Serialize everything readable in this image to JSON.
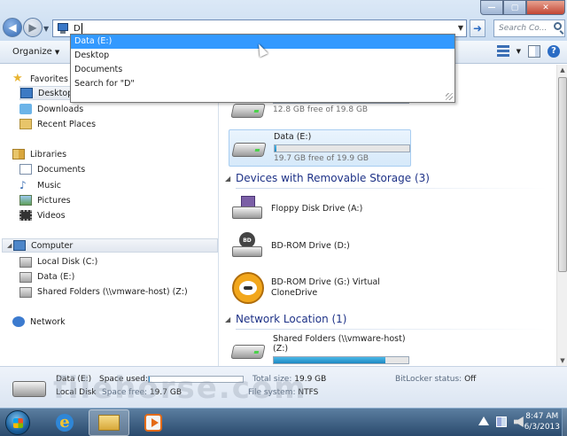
{
  "address_bar": {
    "typed_text": "D",
    "search_placeholder": "Search Co..."
  },
  "autocomplete": {
    "items": [
      "Data (E:)",
      "Desktop",
      "Documents",
      "Search for \"D\""
    ]
  },
  "toolbar": {
    "organize_label": "Organize"
  },
  "nav": {
    "favorites": "Favorites",
    "desktop": "Desktop",
    "downloads": "Downloads",
    "recent_places": "Recent Places",
    "libraries": "Libraries",
    "documents": "Documents",
    "music": "Music",
    "pictures": "Pictures",
    "videos": "Videos",
    "computer": "Computer",
    "local_disk": "Local Disk (C:)",
    "data_e": "Data (E:)",
    "shared_folders": "Shared Folders (\\\\vmware-host) (Z:)",
    "network": "Network"
  },
  "content": {
    "drive_c": {
      "free_text": "12.8 GB free of 19.8 GB",
      "fill_fraction": 0.35
    },
    "drive_e": {
      "name": "Data (E:)",
      "free_text": "19.7 GB free of 19.9 GB",
      "fill_fraction": 0.01
    },
    "removable_header": "Devices with Removable Storage (3)",
    "floppy": "Floppy Disk Drive (A:)",
    "bd_rom": "BD-ROM Drive (D:)",
    "virtual_clone_line1": "BD-ROM Drive (G:) Virtual",
    "virtual_clone_line2": "CloneDrive",
    "network_header": "Network Location (1)",
    "shared_line1": "Shared Folders (\\\\vmware-host)",
    "shared_line2": "(Z:)",
    "shared_fill_fraction": 0.83
  },
  "details": {
    "name": "Data (E:)",
    "type": "Local Disk",
    "space_used_label": "Space used:",
    "space_free_label": "Space free:",
    "space_free_value": "19.7 GB",
    "space_used_fraction": 0.01,
    "total_size_label": "Total size:",
    "total_size_value": "19.9 GB",
    "file_system_label": "File system:",
    "file_system_value": "NTFS",
    "bitlocker_label": "BitLocker status:",
    "bitlocker_value": "Off",
    "watermark": "filehorse.com"
  },
  "taskbar": {
    "time": "8:47 AM",
    "date": "6/3/2013"
  },
  "colors": {
    "accent": "#3399ff",
    "group_header": "#1e3287",
    "drive_fill": "#1d87c2"
  }
}
